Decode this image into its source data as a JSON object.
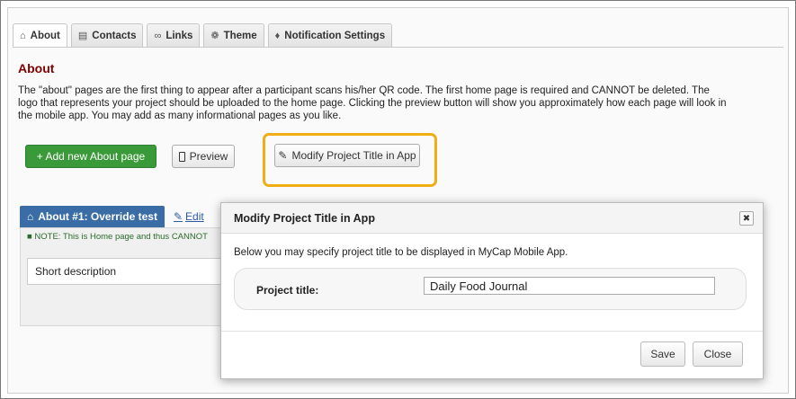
{
  "tabs": [
    {
      "label": "About",
      "icon": "home-icon",
      "active": true
    },
    {
      "label": "Contacts",
      "icon": "contact-card-icon",
      "active": false
    },
    {
      "label": "Links",
      "icon": "link-icon",
      "active": false
    },
    {
      "label": "Theme",
      "icon": "palette-icon",
      "active": false
    },
    {
      "label": "Notification Settings",
      "icon": "bell-icon",
      "active": false
    }
  ],
  "section": {
    "title": "About",
    "description": "The \"about\" pages are the first thing to appear after a participant scans his/her QR code. The first home page is required and CANNOT be deleted. The logo that represents your project should be uploaded to the home page. Clicking the preview button will show you approximately how each page will look in the mobile app. You may add as many informational pages as you like."
  },
  "toolbar": {
    "add_label": "+ Add new About page",
    "preview_label": "Preview",
    "modify_label": "Modify Project Title in App"
  },
  "about_page": {
    "tab_label": "About #1: Override test",
    "edit_label": "Edit",
    "note": "NOTE: This is Home page and thus CANNOT",
    "short_description": "Short description"
  },
  "dialog": {
    "title": "Modify Project Title in App",
    "message": "Below you may specify project title to be displayed in MyCap Mobile App.",
    "field_label": "Project title:",
    "field_value": "Daily Food Journal",
    "save_label": "Save",
    "close_label": "Close"
  },
  "colors": {
    "title": "#800000",
    "add_button": "#3a9a3a",
    "about_tab": "#3a6da5",
    "highlight": "#f0ad16"
  }
}
